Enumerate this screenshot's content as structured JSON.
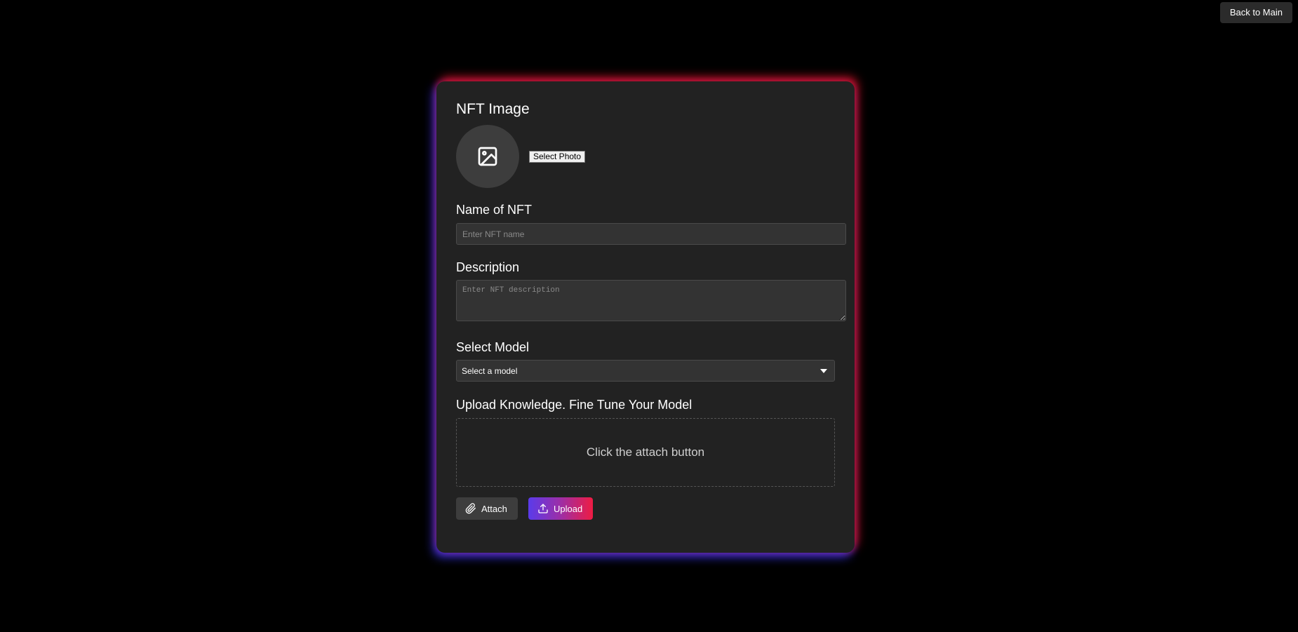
{
  "header": {
    "back_label": "Back to Main"
  },
  "form": {
    "image_section": {
      "title": "NFT Image",
      "select_photo_label": "Select Photo",
      "placeholder_icon": "image-icon"
    },
    "name_section": {
      "title": "Name of NFT",
      "placeholder": "Enter NFT name",
      "value": ""
    },
    "description_section": {
      "title": "Description",
      "placeholder": "Enter NFT description",
      "value": ""
    },
    "model_section": {
      "title": "Select Model",
      "selected_value": "Select a model"
    },
    "upload_section": {
      "title": "Upload Knowledge. Fine Tune Your Model",
      "dropzone_text": "Click the attach button"
    },
    "actions": {
      "attach_label": "Attach",
      "attach_icon": "paperclip-icon",
      "upload_label": "Upload",
      "upload_icon": "upload-icon"
    }
  },
  "colors": {
    "background": "#000000",
    "card": "#222222",
    "glow_red": "#e61428",
    "glow_blue": "#3c3cff",
    "upload_gradient_start": "#5a3bea",
    "upload_gradient_end": "#ee1c43"
  }
}
